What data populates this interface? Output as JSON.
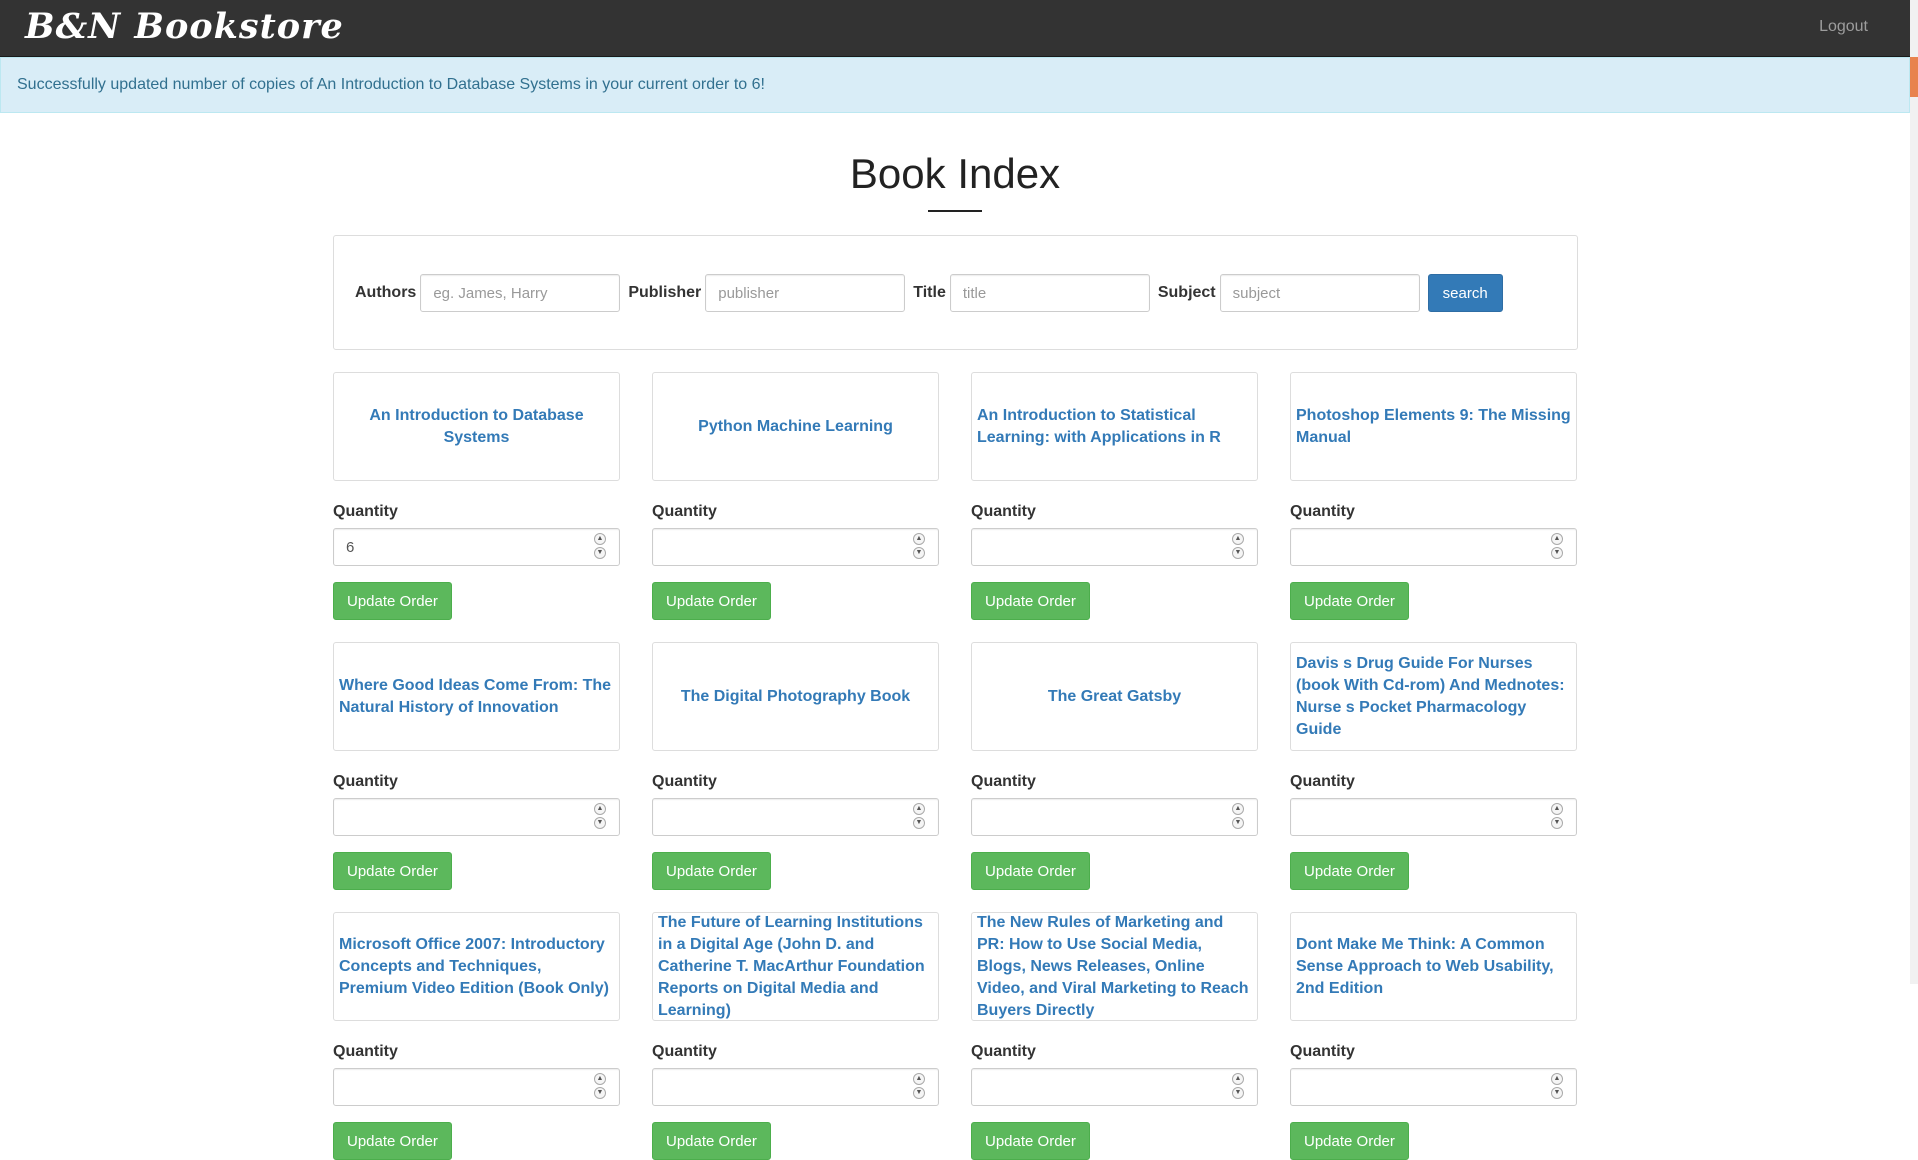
{
  "navbar": {
    "brand": "B&N Bookstore",
    "logout_label": "Logout"
  },
  "alert": {
    "message": "Successfully updated number of copies of An Introduction to Database Systems in your current order to 6!"
  },
  "page": {
    "title": "Book Index"
  },
  "search": {
    "authors_label": "Authors",
    "authors_placeholder": "eg. James, Harry",
    "publisher_label": "Publisher",
    "publisher_placeholder": "publisher",
    "title_label": "Title",
    "title_placeholder": "title",
    "subject_label": "Subject",
    "subject_placeholder": "subject",
    "button_label": "search"
  },
  "books": [
    {
      "title": "An Introduction to Database Systems",
      "quantity": "6"
    },
    {
      "title": "Python Machine Learning",
      "quantity": ""
    },
    {
      "title": "An Introduction to Statistical Learning: with Applications in R",
      "quantity": ""
    },
    {
      "title": "Photoshop Elements 9: The Missing Manual",
      "quantity": ""
    },
    {
      "title": "Where Good Ideas Come From: The Natural History of Innovation",
      "quantity": ""
    },
    {
      "title": "The Digital Photography Book",
      "quantity": ""
    },
    {
      "title": "The Great Gatsby",
      "quantity": ""
    },
    {
      "title": "Davis s Drug Guide For Nurses (book With Cd-rom) And Mednotes: Nurse s Pocket Pharmacology Guide",
      "quantity": ""
    },
    {
      "title": "Microsoft Office 2007: Introductory Concepts and Techniques, Premium Video Edition (Book Only)",
      "quantity": ""
    },
    {
      "title": "The Future of Learning Institutions in a Digital Age (John D. and Catherine T. MacArthur Foundation Reports on Digital Media and Learning)",
      "quantity": ""
    },
    {
      "title": "The New Rules of Marketing and PR: How to Use Social Media, Blogs, News Releases, Online Video, and Viral Marketing to Reach Buyers Directly",
      "quantity": ""
    },
    {
      "title": "Dont Make Me Think: A Common Sense Approach to Web Usability, 2nd Edition",
      "quantity": ""
    }
  ],
  "labels": {
    "quantity": "Quantity",
    "update_order": "Update Order"
  },
  "colors": {
    "navbar": "#333333",
    "alert_bg": "#d9edf7",
    "alert_text": "#31708f",
    "link": "#337ab7",
    "primary_button": "#337ab7",
    "success_button": "#5cb85c",
    "edge_accent": "#e8834e"
  }
}
